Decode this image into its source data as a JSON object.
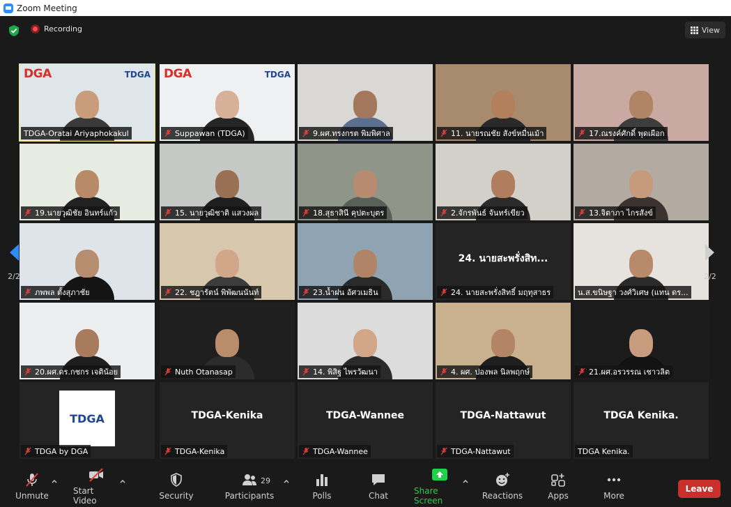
{
  "window": {
    "title": "Zoom Meeting"
  },
  "topbar": {
    "recording_label": "Recording",
    "view_label": "View"
  },
  "pager": {
    "left": "2/2",
    "right": "2/2"
  },
  "tiles": [
    {
      "name": "TDGA-Oratai Ariyaphokakul",
      "big": "",
      "active": true,
      "muted": false,
      "bg": "#dfe6ea",
      "skin": "#c99d7c",
      "shirt": "#3a3a3a",
      "logo": "dga"
    },
    {
      "name": "Suppawan (TDGA)",
      "big": "",
      "active": false,
      "muted": true,
      "bg": "#eef0f2",
      "skin": "#d6b097",
      "shirt": "#262626",
      "logo": "dga"
    },
    {
      "name": "9.ผศ.ทรงกรต พิมพิศาล",
      "big": "",
      "active": false,
      "muted": true,
      "bg": "#d9d8d4",
      "skin": "#a2775b",
      "shirt": "#5d6f8e",
      "logo": ""
    },
    {
      "name": "11. นายรณชัย สังข์หมื่นเม้า",
      "big": "",
      "active": false,
      "muted": true,
      "bg": "#a88a6e",
      "skin": "#b3805e",
      "shirt": "#2a2a2a",
      "logo": ""
    },
    {
      "name": "17.ณรงค์ศักดิ์ พุดเผือก",
      "big": "",
      "active": false,
      "muted": true,
      "bg": "#c9a9a1",
      "skin": "#b08566",
      "shirt": "#3d3d3d",
      "logo": ""
    },
    {
      "name": "19.นายวุฒิชัย อินทร์แก้ว",
      "big": "",
      "active": false,
      "muted": true,
      "bg": "#e7ece3",
      "skin": "#b88a68",
      "shirt": "#222222",
      "logo": ""
    },
    {
      "name": "15. นายวุฒิชาติ แสวงผล",
      "big": "",
      "active": false,
      "muted": true,
      "bg": "#c6c8c6",
      "skin": "#9a7055",
      "shirt": "#1f1f1f",
      "logo": ""
    },
    {
      "name": "18.สุธาสินี คุปตะบุตร",
      "big": "",
      "active": false,
      "muted": true,
      "bg": "#8f9588",
      "skin": "#b88b70",
      "shirt": "#5a5f5a",
      "logo": ""
    },
    {
      "name": "2.จักรพันธ์ จันทร์เขียว",
      "big": "",
      "active": false,
      "muted": true,
      "bg": "#d3d0ca",
      "skin": "#b07d5e",
      "shirt": "#2b2b2b",
      "logo": ""
    },
    {
      "name": "13.จิตาภา ไกรสังข์",
      "big": "",
      "active": false,
      "muted": true,
      "bg": "#b3aaa1",
      "skin": "#c69a7c",
      "shirt": "#3a3330",
      "logo": ""
    },
    {
      "name": "ภพพล ตั้งสุภาชัย",
      "big": "",
      "active": false,
      "muted": true,
      "bg": "#dfe4ea",
      "skin": "#b78d70",
      "shirt": "#141414",
      "logo": ""
    },
    {
      "name": "22. ชฎารัตน์ พิพัฒนนันท์",
      "big": "",
      "active": false,
      "muted": true,
      "bg": "#d7c7ad",
      "skin": "#d2a689",
      "shirt": "#3c3c3c",
      "logo": ""
    },
    {
      "name": "23.น้ำฝน อัศวเมธิน",
      "big": "",
      "active": false,
      "muted": true,
      "bg": "#8fa3b3",
      "skin": "#b08466",
      "shirt": "#2a2a2a",
      "logo": ""
    },
    {
      "name": "24. นายสะพรั่งสิทธิ์ มฤทุสาธร",
      "big": "24. นายสะพรั่งสิท...",
      "active": false,
      "muted": true,
      "bg": "#242424",
      "skin": "",
      "shirt": "",
      "logo": ""
    },
    {
      "name": "น.ส.ขนิษฐา วงศ์วิเศษ (แทน ดร...",
      "big": "",
      "active": false,
      "muted": false,
      "bg": "#e6e3de",
      "skin": "#b78a6b",
      "shirt": "#2b2b2b",
      "logo": ""
    },
    {
      "name": "20.ผศ.ดร.กชกร เจติน้อย",
      "big": "",
      "active": false,
      "muted": true,
      "bg": "#ecedee",
      "skin": "#a77b5c",
      "shirt": "#1e1e1e",
      "logo": ""
    },
    {
      "name": "Nuth Otanasap",
      "big": "",
      "active": false,
      "muted": true,
      "bg": "#1f1f1f",
      "skin": "#b98d6c",
      "shirt": "#2c2c2c",
      "logo": ""
    },
    {
      "name": "14. พิสิฐ ไพรวัฒนา",
      "big": "",
      "active": false,
      "muted": true,
      "bg": "#dcdcdc",
      "skin": "#d2a789",
      "shirt": "#2a2a2a",
      "logo": ""
    },
    {
      "name": "4. ผศ. ปองพล นิลพฤกษ์",
      "big": "",
      "active": false,
      "muted": true,
      "bg": "#c9b08f",
      "skin": "#b38566",
      "shirt": "#1f1f1f",
      "logo": ""
    },
    {
      "name": "21.ผศ.อรวรรณ เชาวลิต",
      "big": "",
      "active": false,
      "muted": true,
      "bg": "#1c1c1c",
      "skin": "#c89d7f",
      "shirt": "#121212",
      "logo": ""
    },
    {
      "name": "TDGA  by DGA",
      "big": "",
      "active": false,
      "muted": true,
      "bg": "#242424",
      "skin": "",
      "shirt": "",
      "logo": "tdgacard"
    },
    {
      "name": "TDGA-Kenika",
      "big": "TDGA-Kenika",
      "active": false,
      "muted": true,
      "bg": "#242424",
      "skin": "",
      "shirt": "",
      "logo": ""
    },
    {
      "name": "TDGA-Wannee",
      "big": "TDGA-Wannee",
      "active": false,
      "muted": true,
      "bg": "#242424",
      "skin": "",
      "shirt": "",
      "logo": ""
    },
    {
      "name": "TDGA-Nattawut",
      "big": "TDGA-Nattawut",
      "active": false,
      "muted": true,
      "bg": "#242424",
      "skin": "",
      "shirt": "",
      "logo": ""
    },
    {
      "name": "TDGA Kenika.",
      "big": "TDGA Kenika.",
      "active": false,
      "muted": false,
      "bg": "#242424",
      "skin": "",
      "shirt": "",
      "logo": ""
    }
  ],
  "logos": {
    "dga": "DGA",
    "tdga": "TDGA"
  },
  "toolbar": {
    "unmute": "Unmute",
    "start_video": "Start Video",
    "security": "Security",
    "participants": "Participants",
    "participants_count": "29",
    "polls": "Polls",
    "chat": "Chat",
    "share_screen": "Share Screen",
    "reactions": "Reactions",
    "apps": "Apps",
    "more": "More",
    "leave": "Leave"
  },
  "colors": {
    "accent_share": "#1fd24a",
    "leave": "#c9302c",
    "active_speaker": "#f2e46a",
    "pager_arrow": "#2d8cff"
  }
}
